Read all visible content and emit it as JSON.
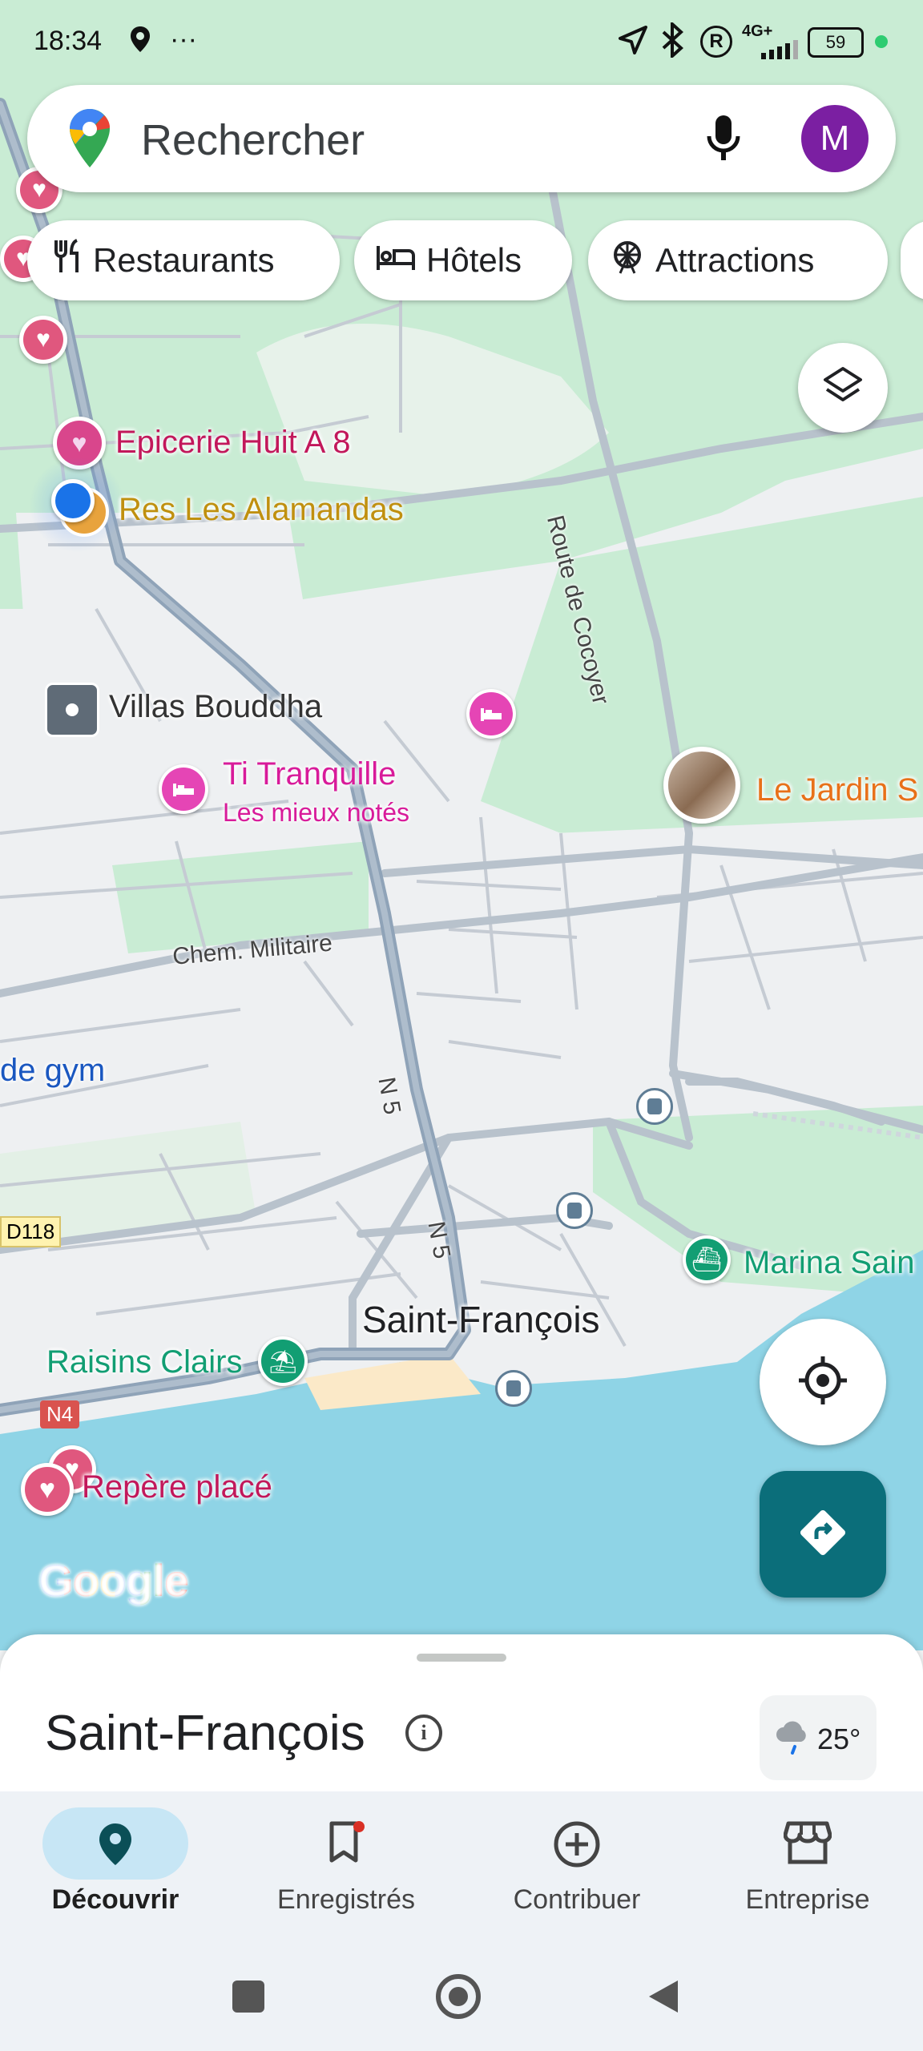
{
  "status_bar": {
    "time": "18:34",
    "more": "···",
    "network": "4G+",
    "battery": "59"
  },
  "search": {
    "placeholder": "Rechercher",
    "avatar_letter": "M"
  },
  "chips": [
    {
      "label": "Restaurants",
      "icon": "fork-knife-icon"
    },
    {
      "label": "Hôtels",
      "icon": "bed-icon"
    },
    {
      "label": "Attractions",
      "icon": "ferris-wheel-icon"
    }
  ],
  "map": {
    "places": [
      {
        "name": "Epicerie Huit A 8",
        "color": "#c2185b"
      },
      {
        "name": "Res Les Alamandas",
        "color": "#c0900f"
      },
      {
        "name": "Villas Bouddha",
        "color": "#333333"
      },
      {
        "name": "Ti Tranquille",
        "color": "#d81b9a"
      },
      {
        "name": "Les mieux notés",
        "color": "#d81b9a"
      },
      {
        "name": "Le Jardin S",
        "color": "#e8711a"
      },
      {
        "name": "de gym",
        "color": "#1a57c0"
      },
      {
        "name": "Marina Sain",
        "color": "#129e73"
      },
      {
        "name": "Raisins Clairs",
        "color": "#129e73"
      },
      {
        "name": "Repère placé",
        "color": "#c2185b"
      },
      {
        "name": "Saint-François",
        "color": "#202124"
      }
    ],
    "roads": {
      "route_cocoyer": "Route de Cocoyer",
      "chem_militaire": "Chem. Militaire",
      "n5_a": "N 5",
      "n5_b": "N 5",
      "d118": "D118",
      "n4": "N4"
    },
    "logo": "Google"
  },
  "sheet": {
    "title": "Saint-François",
    "temperature": "25°"
  },
  "nav": [
    {
      "label": "Découvrir",
      "active": true
    },
    {
      "label": "Enregistrés",
      "active": false
    },
    {
      "label": "Contribuer",
      "active": false
    },
    {
      "label": "Entreprise",
      "active": false
    }
  ],
  "colors": {
    "accent": "#0b6e7a",
    "active_tab_bg": "#c7e6f5",
    "water": "#8fd4e6",
    "forest": "#c9ecd4"
  }
}
